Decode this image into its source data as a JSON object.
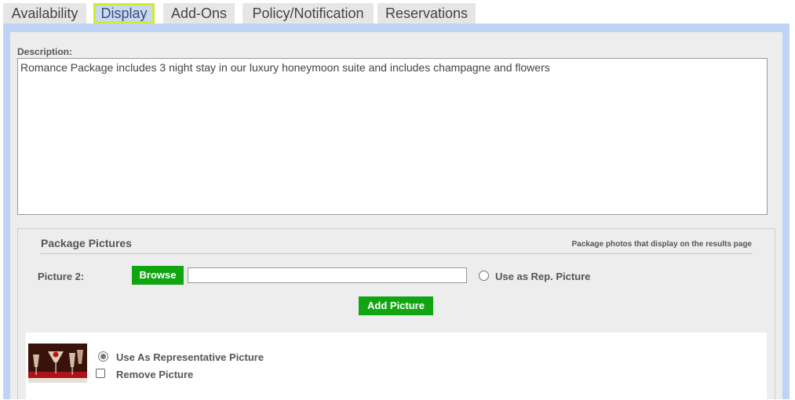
{
  "tabs": [
    {
      "label": "Availability",
      "active": false
    },
    {
      "label": "Display",
      "active": true
    },
    {
      "label": "Add-Ons",
      "active": false
    },
    {
      "label": "Policy/Notification",
      "active": false
    },
    {
      "label": "Reservations",
      "active": false
    }
  ],
  "description": {
    "label": "Description:",
    "value": "Romance Package includes 3 night stay in our luxury honeymoon suite and includes champagne and flowers"
  },
  "package_pictures": {
    "title": "Package Pictures",
    "note": "Package photos that display on the results page",
    "picture_label": "Picture 2:",
    "browse_label": "Browse",
    "file_value": "",
    "rep_picture_label": "Use as Rep. Picture",
    "add_picture_label": "Add Picture",
    "existing": {
      "thumbnail": "champagne-glasses-roses-image",
      "representative_label": "Use As Representative Picture",
      "representative_selected": true,
      "remove_label": "Remove Picture",
      "remove_checked": false
    }
  },
  "colors": {
    "frame": "#bed3f5",
    "panel": "#ededed",
    "active_tab": "#c7d9f5",
    "active_tab_border": "#d4ec2a",
    "button_green": "#11a511"
  }
}
